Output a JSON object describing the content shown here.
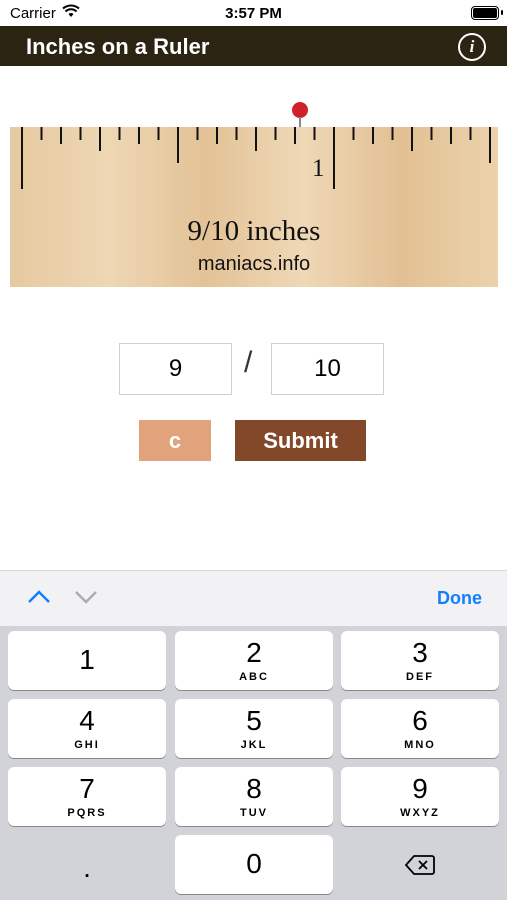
{
  "status": {
    "carrier": "Carrier",
    "time": "3:57 PM"
  },
  "app": {
    "title": "Inches on a Ruler",
    "info_icon": "info-icon",
    "info_label": "i"
  },
  "ruler": {
    "mark_label": "1",
    "measurement_text": "9/10 inches",
    "site": "maniacs.info",
    "pin_value_inches": 0.9
  },
  "answer": {
    "numerator": "9",
    "slash": "/",
    "denominator": "10"
  },
  "buttons": {
    "clear": "c",
    "submit": "Submit"
  },
  "accessory": {
    "done": "Done"
  },
  "keypad": {
    "keys": [
      {
        "num": "1",
        "letters": ""
      },
      {
        "num": "2",
        "letters": "ABC"
      },
      {
        "num": "3",
        "letters": "DEF"
      },
      {
        "num": "4",
        "letters": "GHI"
      },
      {
        "num": "5",
        "letters": "JKL"
      },
      {
        "num": "6",
        "letters": "MNO"
      },
      {
        "num": "7",
        "letters": "PQRS"
      },
      {
        "num": "8",
        "letters": "TUV"
      },
      {
        "num": "9",
        "letters": "WXYZ"
      }
    ],
    "decimal": ".",
    "zero": "0"
  },
  "colors": {
    "navbar": "#2b2412",
    "clear_button": "#e2a27b",
    "submit_button": "#83482a",
    "pin": "#d0202a",
    "done": "#147efb"
  }
}
